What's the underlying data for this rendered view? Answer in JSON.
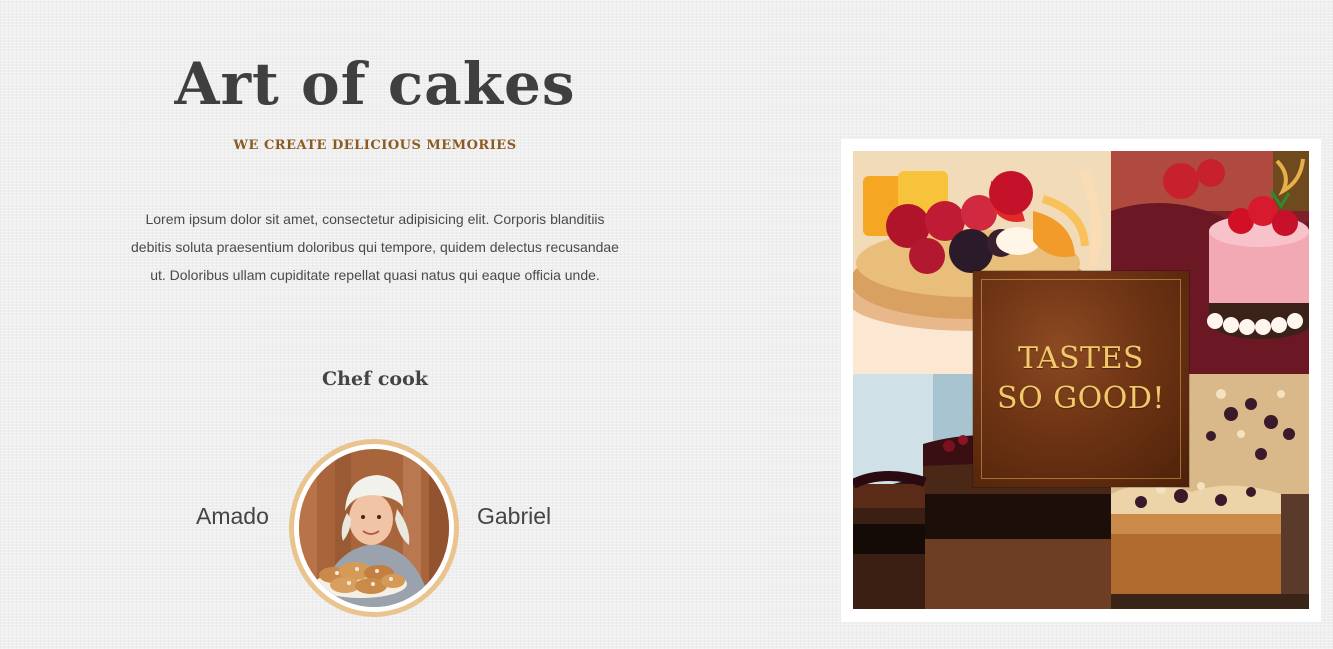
{
  "hero": {
    "title": "Art of cakes",
    "tagline": "WE CREATE DELICIOUS MEMORIES",
    "intro": "Lorem ipsum dolor sit amet, consectetur adipisicing elit. Corporis blanditiis debitis soluta praesentium doloribus qui tempore, quidem delectus recusandae ut. Doloribus ullam cupiditate repellat quasi natus qui eaque officia unde."
  },
  "chef": {
    "heading": "Chef cook",
    "first_name": "Amado",
    "last_name": "Gabriel"
  },
  "gallery": {
    "badge_line1": "TASTES",
    "badge_line2": "SO GOOD!"
  },
  "colors": {
    "title": "#3f3f3f",
    "tagline": "#8a5a22",
    "avatar_ring": "#e9c48f",
    "badge_text": "#f1c86a",
    "badge_bg": "#6e3414"
  }
}
